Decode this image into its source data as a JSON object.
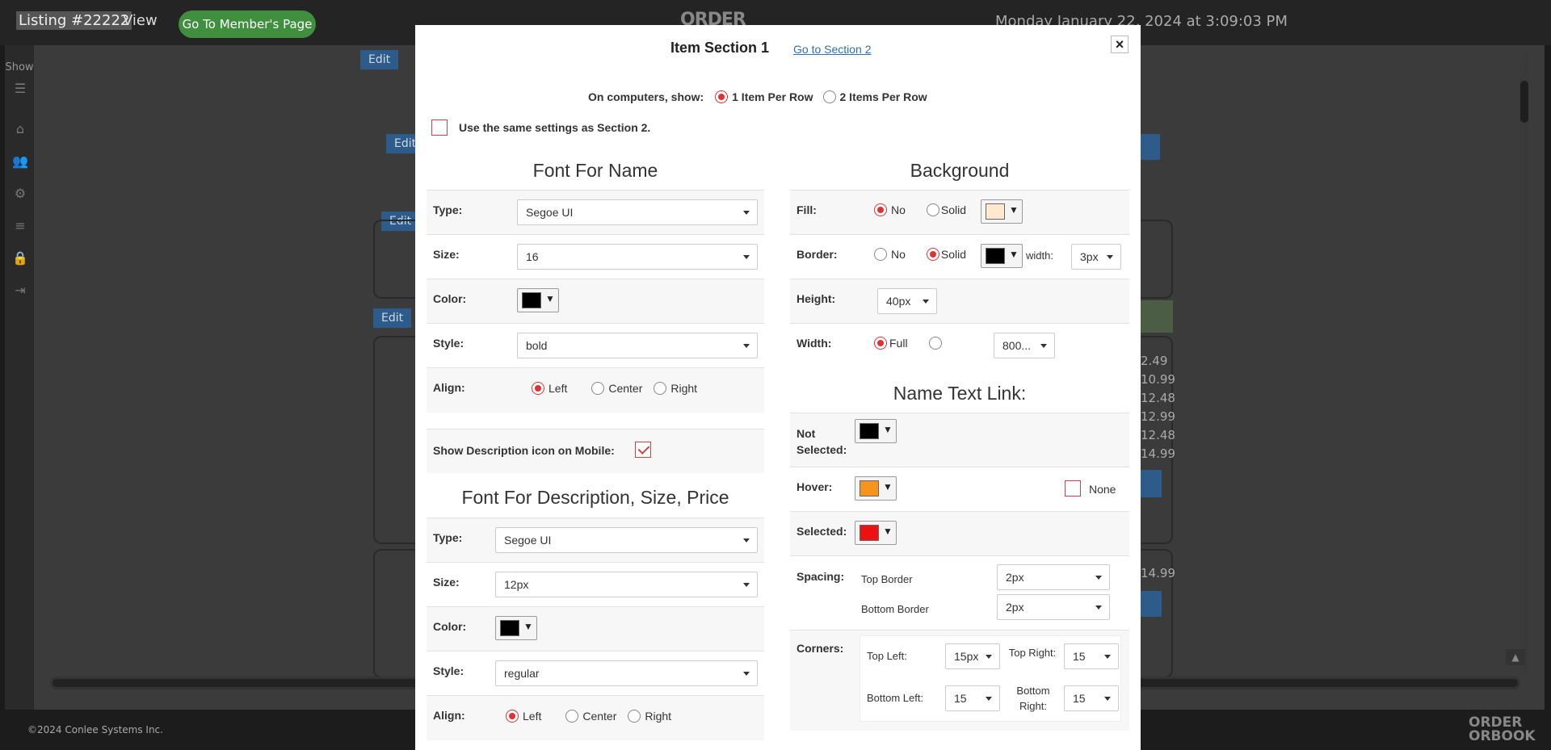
{
  "topbar": {
    "listing": "Listing #22222",
    "view": "View",
    "member_button": "Go To Member's Page",
    "logo": "ORDER",
    "datetime": "Monday January 22, 2024 at 3:09:03 PM"
  },
  "rail": {
    "show": "Show"
  },
  "background": {
    "edit": "Edit",
    "prices": [
      "2.49",
      "10.99",
      "12.48",
      "12.99",
      "12.48",
      "14.99",
      "14.99"
    ]
  },
  "footer": {
    "copyright": "©2024 Conlee Systems Inc.",
    "logo_top": "ORDER",
    "logo_bottom": "ORBOOK"
  },
  "modal": {
    "title": "Item Section 1",
    "goto": "Go to Section 2",
    "close": "×",
    "show_label": "On computers, show:",
    "show_options": [
      "1 Item Per Row",
      "2 Items Per Row"
    ],
    "same_settings": "Use the same settings as Section 2.",
    "font_name": {
      "heading": "Font For Name",
      "type_label": "Type:",
      "type_value": "Segoe UI",
      "size_label": "Size:",
      "size_value": "16",
      "color_label": "Color:",
      "color": "#000000",
      "style_label": "Style:",
      "style_value": "bold",
      "align_label": "Align:",
      "align_options": [
        "Left",
        "Center",
        "Right"
      ]
    },
    "mobile_icon_label": "Show Description icon on Mobile:",
    "font_desc": {
      "heading": "Font For Description, Size, Price",
      "type_label": "Type:",
      "type_value": "Segoe UI",
      "size_label": "Size:",
      "size_value": "12px",
      "color_label": "Color:",
      "color": "#000000",
      "style_label": "Style:",
      "style_value": "regular",
      "align_label": "Align:",
      "align_options": [
        "Left",
        "Center",
        "Right"
      ]
    },
    "background": {
      "heading": "Background",
      "fill_label": "Fill:",
      "fill_options": [
        "No",
        "Solid"
      ],
      "fill_color": "#fde9cf",
      "border_label": "Border:",
      "border_options": [
        "No",
        "Solid"
      ],
      "border_color": "#000000",
      "width_word": "width:",
      "border_width": "3px",
      "height_label": "Height:",
      "height_value": "40px",
      "width_label": "Width:",
      "width_option": "Full",
      "width_value": "800..."
    },
    "name_link": {
      "heading": "Name Text Link:",
      "not_selected_label": "Not Selected:",
      "not_selected_color": "#000000",
      "hover_label": "Hover:",
      "hover_color": "#f7941d",
      "none_label": "None",
      "selected_label": "Selected:",
      "selected_color": "#ee1111"
    },
    "spacing": {
      "label": "Spacing:",
      "top_label": "Top Border",
      "top_value": "2px",
      "bottom_label": "Bottom Border",
      "bottom_value": "2px"
    },
    "corners": {
      "label": "Corners:",
      "top_left_label": "Top Left:",
      "top_left_value": "15px",
      "top_right_label": "Top Right:",
      "top_right_value": "15",
      "bottom_left_label": "Bottom Left:",
      "bottom_left_value": "15",
      "bottom_right_label": "Bottom Right:",
      "bottom_right_value": "15"
    }
  }
}
